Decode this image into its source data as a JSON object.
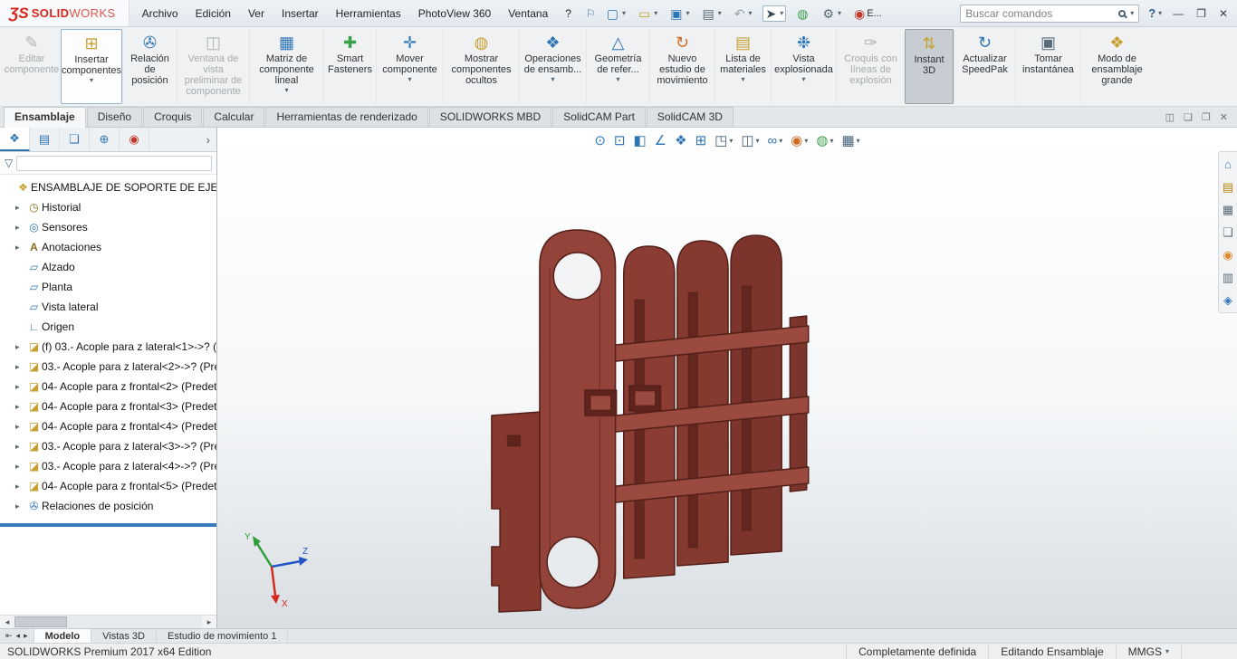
{
  "titlebar": {
    "logo": {
      "mark": "ƷS",
      "solid": "SOLID",
      "works": "WORKS"
    },
    "menus": [
      {
        "name": "menu-archivo",
        "label": "Archivo"
      },
      {
        "name": "menu-edicion",
        "label": "Edición"
      },
      {
        "name": "menu-ver",
        "label": "Ver"
      },
      {
        "name": "menu-insertar",
        "label": "Insertar"
      },
      {
        "name": "menu-herramientas",
        "label": "Herramientas"
      },
      {
        "name": "menu-photoview-360",
        "label": "PhotoView 360"
      },
      {
        "name": "menu-ventana",
        "label": "Ventana"
      },
      {
        "name": "menu-ayuda",
        "label": "?"
      }
    ],
    "pin_glyph": "⚐",
    "quick_access": [
      {
        "name": "new-document-icon",
        "glyph": "▢",
        "style": "color:#2e75b6",
        "dropdown": true
      },
      {
        "name": "open-icon",
        "glyph": "▭",
        "style": "color:#c8a032",
        "dropdown": true
      },
      {
        "name": "save-icon",
        "glyph": "▣",
        "style": "color:#2e75b6",
        "dropdown": true
      },
      {
        "name": "print-icon",
        "glyph": "▤",
        "style": "color:#5a6b7a",
        "dropdown": true
      },
      {
        "name": "undo-icon",
        "glyph": "↶",
        "style": "color:#9aa0a4",
        "dropdown": true
      },
      {
        "name": "select-cursor-icon",
        "glyph": "➤",
        "style": "color:#3a4a56",
        "dropdown": true,
        "pressed": true
      },
      {
        "name": "rebuild-icon",
        "glyph": "◍",
        "style": "color:#3aa04a"
      },
      {
        "name": "options-gear-icon",
        "glyph": "⚙",
        "style": "color:#5a6b7a",
        "dropdown": true
      },
      {
        "name": "edit-appearance-quick-icon",
        "glyph": "◉",
        "style": "color:#c0392b",
        "label": "E..."
      }
    ],
    "search": {
      "placeholder": "Buscar comandos"
    },
    "help": {
      "glyph": "?"
    },
    "window_controls": [
      {
        "name": "minimize-button",
        "glyph": "—"
      },
      {
        "name": "maximize-button",
        "glyph": "❐"
      },
      {
        "name": "close-button",
        "glyph": "✕"
      }
    ]
  },
  "ribbon": {
    "buttons": [
      {
        "name": "edit-component-button",
        "label": "Editar componente",
        "glyph": "✎",
        "style": "color:#a8adb1",
        "btn_style": "width:64px",
        "disabled": true
      },
      {
        "name": "insert-components-button",
        "label": "Insertar componentes",
        "glyph": "⊞",
        "style": "color:#c8a032",
        "btn_style": "width:68px",
        "active": true,
        "dropdown": true
      },
      {
        "name": "mate-button",
        "label": "Relación de posición",
        "glyph": "✇",
        "style": "color:#2e75b6",
        "btn_style": "width:60px"
      },
      {
        "name": "component-preview-window-button",
        "label": "Ventana de vista preliminar de componente",
        "glyph": "◫",
        "style": "color:#a8adb1",
        "btn_style": "width:80px",
        "disabled": true
      },
      {
        "name": "linear-component-pattern-button",
        "label": "Matriz de componente lineal",
        "glyph": "▦",
        "style": "color:#2e75b6",
        "btn_style": "width:82px",
        "dropdown": true
      },
      {
        "name": "smart-fasteners-button",
        "label": "Smart Fasteners",
        "glyph": "✚",
        "style": "color:#3aa04a",
        "btn_style": "width:58px"
      },
      {
        "name": "move-component-button",
        "label": "Mover componente",
        "glyph": "✛",
        "style": "color:#2e75b6",
        "btn_style": "width:74px",
        "dropdown": true
      },
      {
        "name": "show-hidden-components-button",
        "label": "Mostrar componentes ocultos",
        "glyph": "◍",
        "style": "color:#c8a032",
        "btn_style": "width:84px"
      },
      {
        "name": "assembly-features-button",
        "label": "Operaciones de ensamb...",
        "glyph": "❖",
        "style": "color:#2e75b6",
        "btn_style": "width:74px",
        "dropdown": true
      },
      {
        "name": "reference-geometry-button",
        "label": "Geometría de refer...",
        "glyph": "△",
        "style": "color:#2e75b6",
        "btn_style": "width:70px",
        "dropdown": true
      },
      {
        "name": "new-motion-study-button",
        "label": "Nuevo estudio de movimiento",
        "glyph": "↻",
        "style": "color:#d2691e",
        "btn_style": "width:72px"
      },
      {
        "name": "bill-of-materials-button",
        "label": "Lista de materiales",
        "glyph": "▤",
        "style": "color:#c8a032",
        "btn_style": "width:62px",
        "dropdown": true
      },
      {
        "name": "exploded-view-button",
        "label": "Vista explosionada",
        "glyph": "❉",
        "style": "color:#2e75b6",
        "btn_style": "width:72px",
        "dropdown": true
      },
      {
        "name": "explode-line-sketch-button",
        "label": "Croquis con líneas de explosión",
        "glyph": "✑",
        "style": "color:#a8adb1",
        "btn_style": "width:76px",
        "disabled": true
      },
      {
        "name": "instant-3d-button",
        "label": "Instant 3D",
        "glyph": "⇅",
        "style": "color:#c8a032",
        "btn_style": "width:54px",
        "selected": true
      },
      {
        "name": "update-speedpak-button",
        "label": "Actualizar SpeedPak",
        "glyph": "↻",
        "style": "color:#2e75b6",
        "btn_style": "width:68px"
      },
      {
        "name": "take-snapshot-button",
        "label": "Tomar instantánea",
        "glyph": "▣",
        "style": "color:#5a6b7a",
        "btn_style": "width:72px"
      },
      {
        "name": "large-assembly-mode-button",
        "label": "Modo de ensamblaje grande",
        "glyph": "❖",
        "style": "color:#c8a032",
        "btn_style": "width:80px"
      }
    ]
  },
  "tabbar": {
    "tabs": [
      {
        "name": "tab-ensamblaje",
        "label": "Ensamblaje",
        "active": true
      },
      {
        "name": "tab-diseno",
        "label": "Diseño"
      },
      {
        "name": "tab-croquis",
        "label": "Croquis"
      },
      {
        "name": "tab-calcular",
        "label": "Calcular"
      },
      {
        "name": "tab-herramientas-renderizado",
        "label": "Herramientas de renderizado"
      },
      {
        "name": "tab-solidworks-mbd",
        "label": "SOLIDWORKS MBD"
      },
      {
        "name": "tab-solidcam-part",
        "label": "SolidCAM Part"
      },
      {
        "name": "tab-solidcam-3d",
        "label": "SolidCAM 3D"
      }
    ],
    "pane_icons": [
      {
        "name": "pane-arrange-icon",
        "glyph": "◫"
      },
      {
        "name": "pane-maximize-icon",
        "glyph": "❏"
      },
      {
        "name": "pane-float-icon",
        "glyph": "❐"
      },
      {
        "name": "pane-close-icon",
        "glyph": "✕"
      }
    ]
  },
  "sidebar": {
    "panel_tabs": [
      {
        "name": "feature-manager-tab",
        "glyph": "❖",
        "style": "color:#2e75b6",
        "active": true
      },
      {
        "name": "property-manager-tab",
        "glyph": "▤",
        "style": "color:#2e75b6"
      },
      {
        "name": "configuration-manager-tab",
        "glyph": "❏",
        "style": "color:#2e75b6"
      },
      {
        "name": "dimxpert-manager-tab",
        "glyph": "⊕",
        "style": "color:#2e75b6"
      },
      {
        "name": "display-manager-tab",
        "glyph": "◉",
        "style": "color:#c0392b"
      }
    ],
    "expand_glyph": "›",
    "filter_glyph": "▽",
    "items": [
      {
        "icon": "assembly-icon",
        "glyph": "❖",
        "style": "color:#c8a032",
        "label": "ENSAMBLAJE DE SOPORTE DE EJE Z (Pre",
        "is_root": true
      },
      {
        "icon": "history-folder-icon",
        "glyph": "◷",
        "style": "color:#8a6d1f",
        "label": "Historial",
        "arrow": true
      },
      {
        "icon": "sensors-icon",
        "glyph": "◎",
        "style": "color:#2e75b6",
        "label": "Sensores",
        "arrow": true
      },
      {
        "icon": "annotations-icon",
        "glyph": "A",
        "style": "color:#8a6d1f;font-weight:bold",
        "label": "Anotaciones",
        "arrow": true
      },
      {
        "icon": "plane-icon",
        "glyph": "▱",
        "style": "color:#2e75b6",
        "label": "Alzado"
      },
      {
        "icon": "plane-icon",
        "glyph": "▱",
        "style": "color:#2e75b6",
        "label": "Planta"
      },
      {
        "icon": "plane-icon",
        "glyph": "▱",
        "style": "color:#2e75b6",
        "label": "Vista lateral"
      },
      {
        "icon": "origin-icon",
        "glyph": "∟",
        "style": "color:#2e75b6",
        "label": "Origen"
      },
      {
        "icon": "part-icon",
        "glyph": "◪",
        "style": "color:#c8a032",
        "label": "(f) 03.- Acople para z lateral<1>->? (",
        "arrow": true
      },
      {
        "icon": "part-icon",
        "glyph": "◪",
        "style": "color:#c8a032",
        "label": "03.- Acople para z lateral<2>->? (Pre",
        "arrow": true
      },
      {
        "icon": "part-icon",
        "glyph": "◪",
        "style": "color:#c8a032",
        "label": "04- Acople para z frontal<2> (Predet",
        "arrow": true
      },
      {
        "icon": "part-icon",
        "glyph": "◪",
        "style": "color:#c8a032",
        "label": "04- Acople para z frontal<3> (Predet",
        "arrow": true
      },
      {
        "icon": "part-icon",
        "glyph": "◪",
        "style": "color:#c8a032",
        "label": "04- Acople para z frontal<4> (Predet",
        "arrow": true
      },
      {
        "icon": "part-icon",
        "glyph": "◪",
        "style": "color:#c8a032",
        "label": "03.- Acople para z lateral<3>->? (Pre",
        "arrow": true
      },
      {
        "icon": "part-icon",
        "glyph": "◪",
        "style": "color:#c8a032",
        "label": "03.- Acople para z lateral<4>->? (Pre",
        "arrow": true
      },
      {
        "icon": "part-icon",
        "glyph": "◪",
        "style": "color:#c8a032",
        "label": "04- Acople para z frontal<5> (Predet",
        "arrow": true
      },
      {
        "icon": "mates-icon",
        "glyph": "✇",
        "style": "color:#2e75b6",
        "label": "Relaciones de posición",
        "arrow": true
      }
    ]
  },
  "viewport": {
    "headsup": [
      {
        "name": "zoom-to-fit-icon",
        "glyph": "⊙",
        "style": "color:#2e75b6"
      },
      {
        "name": "zoom-to-area-icon",
        "glyph": "⊡",
        "style": "color:#2e75b6"
      },
      {
        "name": "section-view-icon",
        "glyph": "◧",
        "style": "color:#2e75b6"
      },
      {
        "name": "measure-icon",
        "glyph": "∠",
        "style": "color:#2e75b6"
      },
      {
        "name": "assembly-visualization-icon",
        "glyph": "❖",
        "style": "color:#2e75b6"
      },
      {
        "name": "display-states-icon",
        "glyph": "⊞",
        "style": "color:#2e75b6"
      },
      {
        "name": "view-orientation-icon",
        "glyph": "◳",
        "style": "color:#44617a",
        "dropdown": true
      },
      {
        "name": "display-style-icon",
        "glyph": "◫",
        "style": "color:#44617a",
        "dropdown": true
      },
      {
        "name": "hide-show-items-icon",
        "glyph": "∞",
        "style": "color:#2e75b6",
        "dropdown": true
      },
      {
        "name": "edit-appearance-icon",
        "glyph": "◉",
        "style": "color:#d2691e",
        "dropdown": true
      },
      {
        "name": "apply-scene-icon",
        "glyph": "◍",
        "style": "color:#3aa04a",
        "dropdown": true
      },
      {
        "name": "view-settings-icon",
        "glyph": "▦",
        "style": "color:#44617a",
        "dropdown": true
      }
    ],
    "triad": {
      "x": "X",
      "y": "Y",
      "z": "Z"
    },
    "model_color": "#8d4037"
  },
  "taskpane": {
    "icons": [
      {
        "name": "home-icon",
        "glyph": "⌂",
        "style": "color:#4a7ab5"
      },
      {
        "name": "design-library-icon",
        "glyph": "▤",
        "style": "color:#b8860b"
      },
      {
        "name": "file-explorer-icon",
        "glyph": "▦",
        "style": "color:#5a6b7a"
      },
      {
        "name": "view-palette-icon",
        "glyph": "❏",
        "style": "color:#5a6b7a"
      },
      {
        "name": "appearances-icon",
        "glyph": "◉",
        "style": "color:#e08a2e"
      },
      {
        "name": "custom-properties-icon",
        "glyph": "▥",
        "style": "color:#5a6b7a"
      },
      {
        "name": "forum-icon",
        "glyph": "◈",
        "style": "color:#2e75b6"
      }
    ]
  },
  "bottom": {
    "controls": [
      {
        "name": "pane-splitter-icon",
        "glyph": "⇤"
      },
      {
        "name": "scroll-tabs-left-icon",
        "glyph": "◂"
      },
      {
        "name": "scroll-tabs-right-icon",
        "glyph": "▸"
      }
    ],
    "tabs": [
      {
        "name": "tab-modelo",
        "label": "Modelo",
        "active": true
      },
      {
        "name": "tab-vistas-3d",
        "label": "Vistas 3D"
      },
      {
        "name": "tab-estudio-de-movimiento-1",
        "label": "Estudio de movimiento 1"
      }
    ]
  },
  "statusbar": {
    "left": "SOLIDWORKS Premium 2017 x64 Edition",
    "items": [
      {
        "name": "status-fully-defined",
        "label": "Completamente definida"
      },
      {
        "name": "status-editing-assembly",
        "label": "Editando Ensamblaje"
      },
      {
        "name": "status-units",
        "label": "MMGS",
        "dropdown": true
      }
    ]
  }
}
